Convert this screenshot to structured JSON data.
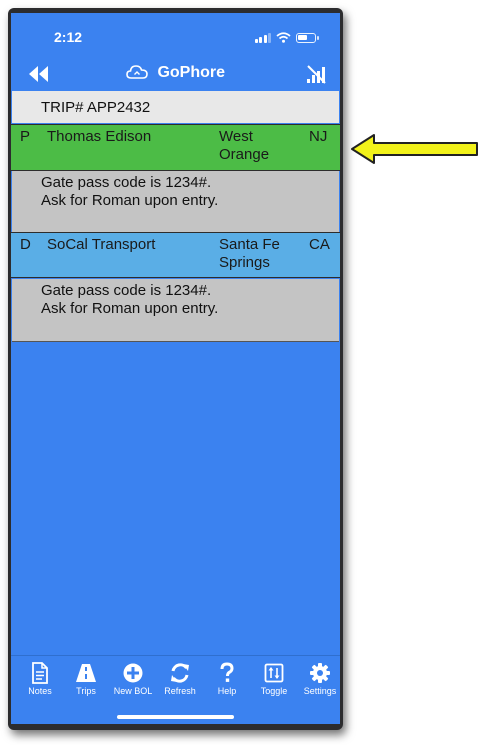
{
  "status": {
    "time": "2:12"
  },
  "header": {
    "app_name": "GoPhore"
  },
  "trip": {
    "label": "TRIP# APP2432"
  },
  "stops": [
    {
      "type": "P",
      "name": "Thomas Edison",
      "city_line1": "West",
      "city_line2": "Orange",
      "state": "NJ",
      "color": "#4cbc46",
      "note": "Gate pass code is 1234#. Ask for Roman upon entry."
    },
    {
      "type": "D",
      "name": "SoCal Transport",
      "city_line1": "Santa Fe",
      "city_line2": "Springs",
      "state": "CA",
      "color": "#5aaee6",
      "note": "Gate pass code is 1234#. Ask for Roman upon entry."
    }
  ],
  "tabs": [
    {
      "label": "Notes",
      "icon": "document-icon"
    },
    {
      "label": "Trips",
      "icon": "road-icon"
    },
    {
      "label": "New BOL",
      "icon": "plus-circle-icon"
    },
    {
      "label": "Refresh",
      "icon": "refresh-icon"
    },
    {
      "label": "Help",
      "icon": "question-icon"
    },
    {
      "label": "Toggle",
      "icon": "toggle-icon"
    },
    {
      "label": "Settings",
      "icon": "gear-icon"
    }
  ],
  "colors": {
    "primary_blue": "#3b82f0",
    "annotation_arrow": "#f2f21a"
  }
}
